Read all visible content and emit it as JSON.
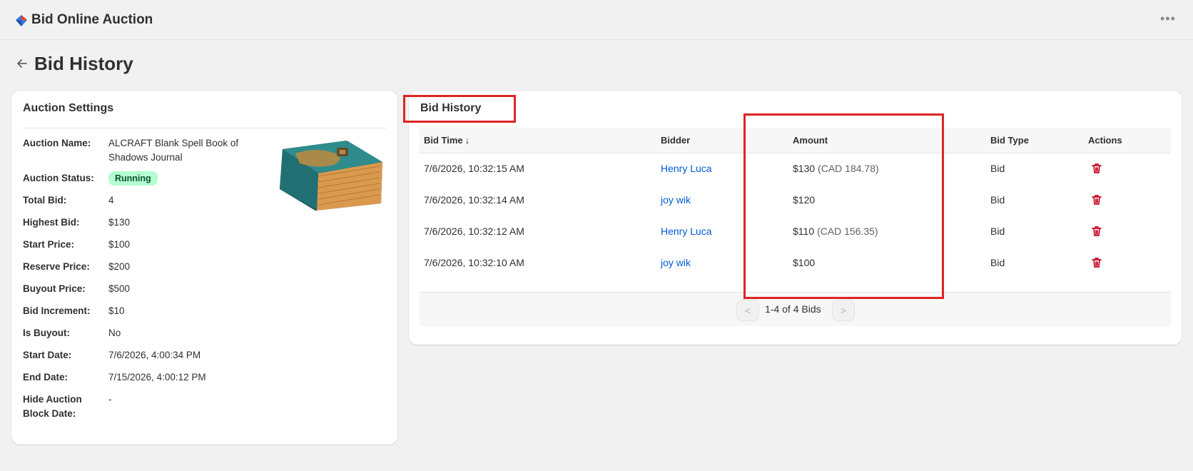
{
  "app": {
    "title": "Bid Online Auction",
    "more_label": "•••"
  },
  "page": {
    "title": "Bid History"
  },
  "settings": {
    "heading": "Auction Settings",
    "fields": [
      {
        "label": "Auction Name:",
        "value": "ALCRAFT Blank Spell Book of Shadows Journal"
      },
      {
        "label": "Auction Status:",
        "value": "Running"
      },
      {
        "label": "Total Bid:",
        "value": "4"
      },
      {
        "label": "Highest Bid:",
        "value": "$130"
      },
      {
        "label": "Start Price:",
        "value": "$100"
      },
      {
        "label": "Reserve Price:",
        "value": "$200"
      },
      {
        "label": "Buyout Price:",
        "value": "$500"
      },
      {
        "label": "Bid Increment:",
        "value": "$10"
      },
      {
        "label": "Is Buyout:",
        "value": "No"
      },
      {
        "label": "Start Date:",
        "value": "7/6/2026, 4:00:34 PM"
      },
      {
        "label": "End Date:",
        "value": "7/15/2026, 4:00:12 PM"
      },
      {
        "label": "Hide Auction Block Date:",
        "value": "-"
      }
    ],
    "status_color": "#b4fed2"
  },
  "history": {
    "heading": "Bid History",
    "columns": [
      "Bid Time",
      "Bidder",
      "Amount",
      "Bid Type",
      "Actions"
    ],
    "sort_arrow": "↓",
    "rows": [
      {
        "time": "7/6/2026, 10:32:15 AM",
        "bidder": "Henry Luca",
        "amount": "$130",
        "cad": "(CAD 184.78)",
        "type": "Bid"
      },
      {
        "time": "7/6/2026, 10:32:14 AM",
        "bidder": "joy wik",
        "amount": "$120",
        "cad": "",
        "type": "Bid"
      },
      {
        "time": "7/6/2026, 10:32:12 AM",
        "bidder": "Henry Luca",
        "amount": "$110",
        "cad": "(CAD 156.35)",
        "type": "Bid"
      },
      {
        "time": "7/6/2026, 10:32:10 AM",
        "bidder": "joy wik",
        "amount": "$100",
        "cad": "",
        "type": "Bid"
      }
    ],
    "pagination": {
      "prev": "<",
      "info": "1-4 of 4 Bids",
      "next": ">"
    },
    "link_color": "#005bd3",
    "delete_color": "#c70a24"
  },
  "highlight_color": "#e02424"
}
